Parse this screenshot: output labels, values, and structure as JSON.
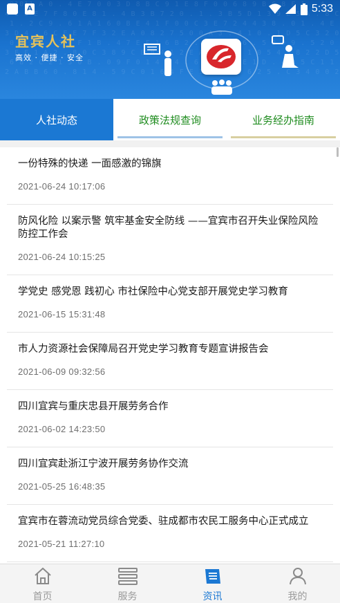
{
  "status_bar": {
    "time": "5:33"
  },
  "header": {
    "brand_title": "宜宾人社",
    "brand_subtitle": "高效 · 便捷 · 安全"
  },
  "tabs": [
    {
      "label": "人社动态",
      "active": true
    },
    {
      "label": "政策法规查询",
      "active": false
    },
    {
      "label": "业务经办指南",
      "active": false
    }
  ],
  "news": [
    {
      "title": "一份特殊的快递 一面感激的锦旗",
      "date": "2021-06-24 10:17:06"
    },
    {
      "title": "防风化险 以案示警 筑牢基金安全防线 ——宜宾市召开失业保险风险防控工作会",
      "date": "2021-06-24 10:15:25"
    },
    {
      "title": "学党史 感党恩 践初心 市社保险中心党支部开展党史学习教育",
      "date": "2021-06-15 15:31:48"
    },
    {
      "title": "市人力资源社会保障局召开党史学习教育专题宣讲报告会",
      "date": "2021-06-09 09:32:56"
    },
    {
      "title": "四川宜宾与重庆忠县开展劳务合作",
      "date": "2021-06-02 14:23:50"
    },
    {
      "title": "四川宜宾赴浙江宁波开展劳务协作交流",
      "date": "2021-05-25 16:48:35"
    },
    {
      "title": "宜宾市在蓉流动党员综合党委、驻成都市农民工服务中心正式成立",
      "date": "2021-05-21 11:27:10"
    }
  ],
  "bottom_nav": [
    {
      "label": "首页",
      "icon": "home-icon",
      "active": false
    },
    {
      "label": "服务",
      "icon": "menu-icon",
      "active": false
    },
    {
      "label": "资讯",
      "icon": "news-icon",
      "active": true
    },
    {
      "label": "我的",
      "icon": "user-icon",
      "active": false
    }
  ],
  "colors": {
    "primary": "#1b78d3",
    "tab_text": "#1f8c1f",
    "brand_gold": "#e6c25a",
    "logo_red": "#d8262b"
  }
}
